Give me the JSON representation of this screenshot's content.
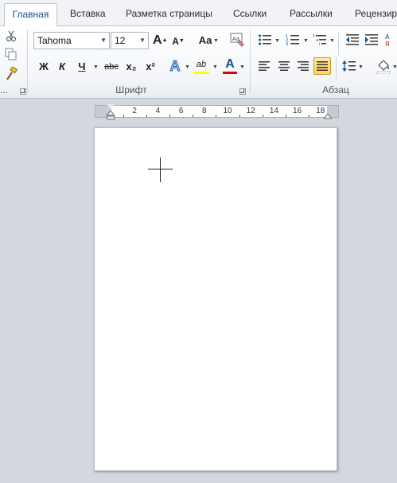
{
  "tabs": [
    {
      "label": "Главная",
      "active": true
    },
    {
      "label": "Вставка"
    },
    {
      "label": "Разметка страницы"
    },
    {
      "label": "Ссылки"
    },
    {
      "label": "Рассылки"
    },
    {
      "label": "Рецензир"
    }
  ],
  "font": {
    "name": "Tahoma",
    "size": "12",
    "grow_label": "A",
    "shrink_label": "A",
    "case_label": "Aa",
    "bold": "Ж",
    "italic": "К",
    "underline": "Ч",
    "strike": "abc",
    "subscript": "x₂",
    "superscript": "x²",
    "text_effects": "A",
    "highlight": "ab",
    "font_color": "A",
    "group_label": "Шрифт"
  },
  "paragraph": {
    "group_label": "Абзац"
  },
  "clipboard": {
    "group_label_fragment": "..."
  },
  "colors": {
    "accent_blue": "#1a4f8b",
    "highlight_yellow": "#ffff00",
    "font_red": "#e0000f",
    "selected_button": "#ffd45c"
  },
  "ruler": {
    "labels": [
      "2",
      "4",
      "6",
      "8",
      "10",
      "12",
      "14",
      "16",
      "18"
    ]
  }
}
